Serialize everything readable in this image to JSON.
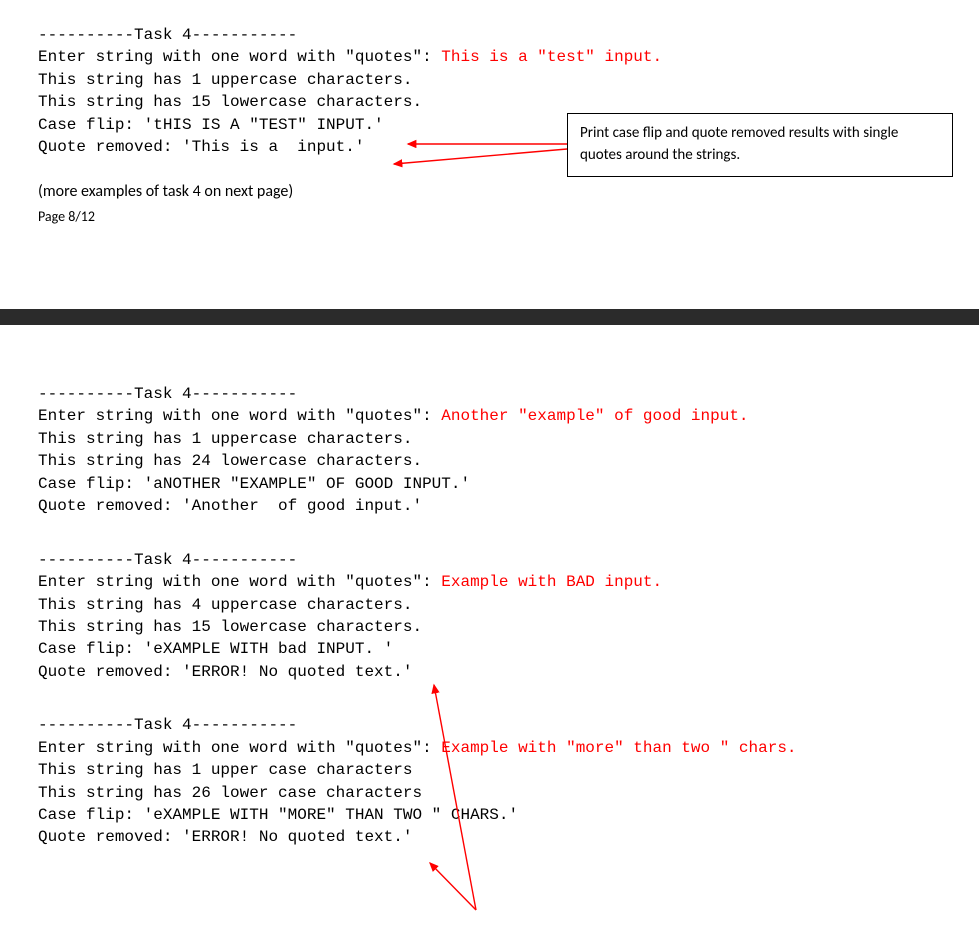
{
  "page1": {
    "header": "----------Task 4-----------",
    "blank": "",
    "prompt_label": "Enter string with one word with \"quotes\": ",
    "prompt_input": "This is a \"test\" input.",
    "upper": "This string has 1 uppercase characters.",
    "lower": "This string has 15 lowercase characters.",
    "caseflip": "Case flip: 'tHIS IS A \"TEST\" INPUT.'",
    "quoterem": "Quote removed: 'This is a  input.'",
    "more": "(more examples of task 4 on next page)",
    "pagecount": "Page 8/12"
  },
  "callout": {
    "text": "Print case flip and quote removed results with single quotes around the strings."
  },
  "page2": {
    "ex1": {
      "header": "----------Task 4-----------",
      "prompt_label": "Enter string with one word with \"quotes\": ",
      "prompt_input": "Another \"example\" of good input.",
      "upper": "This string has 1 uppercase characters.",
      "lower": "This string has 24 lowercase characters.",
      "caseflip": "Case flip: 'aNOTHER \"EXAMPLE\" OF GOOD INPUT.'",
      "quoterem": "Quote removed: 'Another  of good input.'"
    },
    "ex2": {
      "header": "----------Task 4-----------",
      "prompt_label": "Enter string with one word with \"quotes\": ",
      "prompt_input": "Example with BAD input.",
      "upper": "This string has 4 uppercase characters.",
      "lower": "This string has 15 lowercase characters.",
      "caseflip": "Case flip: 'eXAMPLE WITH bad INPUT. '",
      "quoterem": "Quote removed: 'ERROR! No quoted text.'"
    },
    "ex3": {
      "header": "----------Task 4-----------",
      "prompt_label": "Enter string with one word with \"quotes\": ",
      "prompt_input": "Example with \"more\" than two \" chars.",
      "upper": "This string has 1 upper case characters",
      "lower": "This string has 26 lower case characters",
      "caseflip": "Case flip: 'eXAMPLE WITH \"MORE\" THAN TWO \" CHARS.'",
      "quoterem": "Quote removed: 'ERROR! No quoted text.'"
    }
  }
}
